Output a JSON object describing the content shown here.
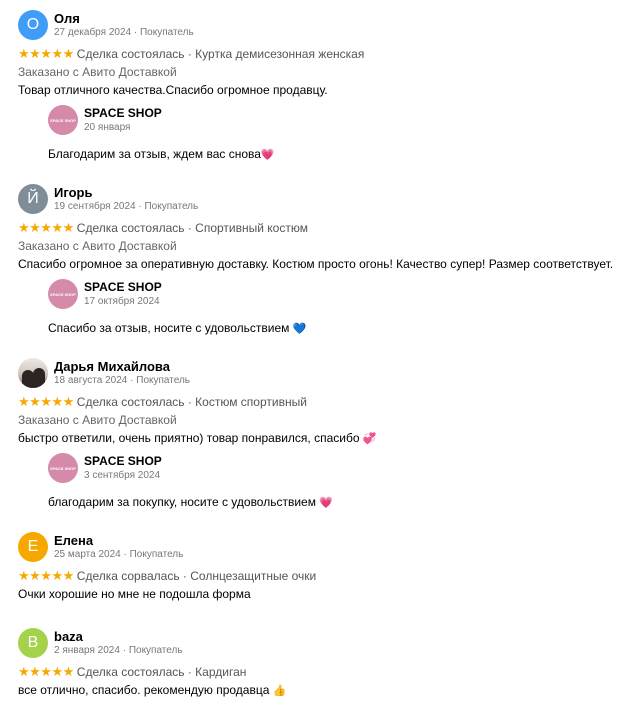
{
  "reviews": [
    {
      "avatar": {
        "letter": "О",
        "color": "#3f9cf7"
      },
      "name": "Оля",
      "meta": "27 декабря 2024 · Покупатель",
      "stars": "★★★★★",
      "status": "Сделка состоялась · Куртка демисезонная женская",
      "delivery": "Заказано с Авито Доставкой",
      "text": "Товар отличного качества.Спасибо огромное продавцу.",
      "reply": {
        "shop": "SPACE SHOP",
        "logo": "SPACE SHOP",
        "date": "20 января",
        "text": "Благодарим за отзыв, ждем вас снова",
        "emoji": "💗"
      }
    },
    {
      "avatar": {
        "letter": "Й",
        "color": "#7f8d99"
      },
      "name": "Игорь",
      "meta": "19 сентября 2024 · Покупатель",
      "stars": "★★★★★",
      "status": "Сделка состоялась · Спортивный костюм",
      "delivery": "Заказано с Авито Доставкой",
      "text": "Спасибо огромное за оперативную доставку. Костюм просто огонь! Качество супер! Размер соответствует.",
      "reply": {
        "shop": "SPACE SHOP",
        "logo": "SPACE SHOP",
        "date": "17 октября 2024",
        "text": "Спасибо за отзыв, носите с удовольствием",
        "emoji": "💙"
      }
    },
    {
      "avatar": {
        "letter": "",
        "color": "#cfc4bc"
      },
      "name": "Дарья Михайлова",
      "meta": "18 августа 2024 · Покупатель",
      "stars": "★★★★★",
      "status": "Сделка состоялась · Костюм спортивный",
      "delivery": "Заказано с Авито Доставкой",
      "text": "быстро ответили, очень приятно) товар понравился, спасибо",
      "text_emoji": "💞",
      "reply": {
        "shop": "SPACE SHOP",
        "logo": "SPACE SHOP",
        "date": "3 сентября 2024",
        "text": "благодарим за покупку, носите с удовольствием",
        "emoji": "💗"
      }
    },
    {
      "avatar": {
        "letter": "Е",
        "color": "#f7a800"
      },
      "name": "Елена",
      "meta": "25 марта 2024 · Покупатель",
      "stars": "★★★★★",
      "status": "Сделка сорвалась · Солнцезащитные очки",
      "text": "Очки хорошие но мне не подошла форма"
    },
    {
      "avatar": {
        "letter": "B",
        "color": "#a4d24a"
      },
      "name": "baza",
      "meta": "2 января 2024 · Покупатель",
      "stars": "★★★★★",
      "status": "Сделка состоялась · Кардиган",
      "text": "все отлично, спасибо. рекомендую продавца",
      "text_emoji": "👍"
    }
  ]
}
